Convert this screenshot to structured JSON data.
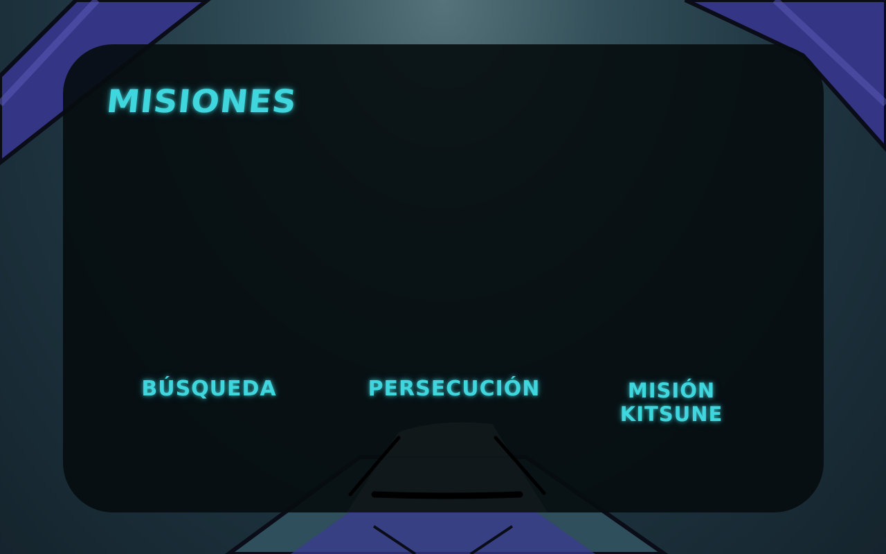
{
  "panel": {
    "title": "MISIONES"
  },
  "missions": [
    {
      "label": "BÚSQUEDA"
    },
    {
      "label": "PERSECUCIÓN"
    },
    {
      "label": "MISIÓN\nKITSUNE"
    }
  ],
  "colors": {
    "accent": "#3fd6de",
    "panel_bg": "#060c0e",
    "frame_purple": "#3a3b8f",
    "backdrop": "#1f3642"
  }
}
